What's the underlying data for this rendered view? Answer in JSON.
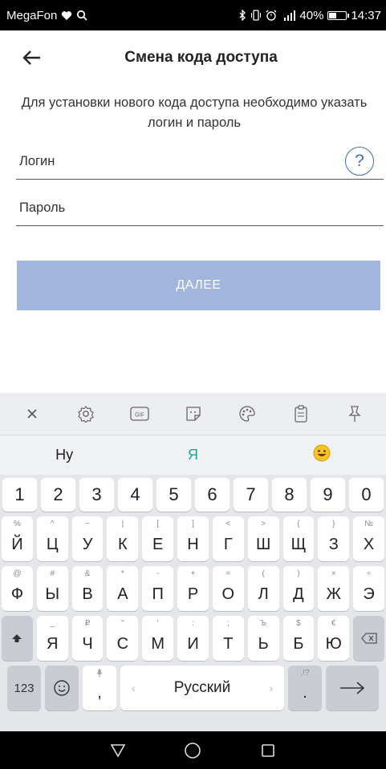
{
  "status_bar": {
    "carrier": "MegaFon",
    "battery": "40%",
    "battery_level": 0.4,
    "time": "14:37"
  },
  "header": {
    "title": "Смена кода доступа"
  },
  "instructions": "Для установки нового кода доступа необходимо указать логин и пароль",
  "login": {
    "placeholder": "Логин",
    "help_label": "?"
  },
  "password": {
    "placeholder": "Пароль"
  },
  "next_button": "ДАЛЕЕ",
  "keyboard": {
    "suggestions": [
      "Ну",
      "Я"
    ],
    "number_row": [
      "1",
      "2",
      "3",
      "4",
      "5",
      "6",
      "7",
      "8",
      "9",
      "0"
    ],
    "row1": [
      {
        "main": "Й",
        "sup": "%"
      },
      {
        "main": "Ц",
        "sup": "^"
      },
      {
        "main": "У",
        "sup": "~"
      },
      {
        "main": "К",
        "sup": "|"
      },
      {
        "main": "Е",
        "sup": "["
      },
      {
        "main": "Н",
        "sup": "]"
      },
      {
        "main": "Г",
        "sup": "<"
      },
      {
        "main": "Ш",
        "sup": ">"
      },
      {
        "main": "Щ",
        "sup": "{"
      },
      {
        "main": "З",
        "sup": "}"
      },
      {
        "main": "Х",
        "sup": "№"
      }
    ],
    "row2": [
      {
        "main": "Ф",
        "sup": "@"
      },
      {
        "main": "Ы",
        "sup": "#"
      },
      {
        "main": "В",
        "sup": "&"
      },
      {
        "main": "А",
        "sup": "*"
      },
      {
        "main": "П",
        "sup": "-"
      },
      {
        "main": "Р",
        "sup": "+"
      },
      {
        "main": "О",
        "sup": "="
      },
      {
        "main": "Л",
        "sup": "("
      },
      {
        "main": "Д",
        "sup": ")"
      },
      {
        "main": "Ж",
        "sup": "×"
      },
      {
        "main": "Э",
        "sup": "÷"
      }
    ],
    "row3": [
      {
        "main": "Я",
        "sup": "_"
      },
      {
        "main": "Ч",
        "sup": "₽"
      },
      {
        "main": "С",
        "sup": "\""
      },
      {
        "main": "М",
        "sup": "'"
      },
      {
        "main": "И",
        "sup": ":"
      },
      {
        "main": "Т",
        "sup": ";"
      },
      {
        "main": "Ь",
        "sup": "Ъ"
      },
      {
        "main": "Б",
        "sup": "$"
      },
      {
        "main": "Ю",
        "sup": "€"
      }
    ],
    "key_123": "123",
    "comma": ",",
    "space_label": "Русский",
    "period": ".",
    "period_hint": ",!?"
  }
}
